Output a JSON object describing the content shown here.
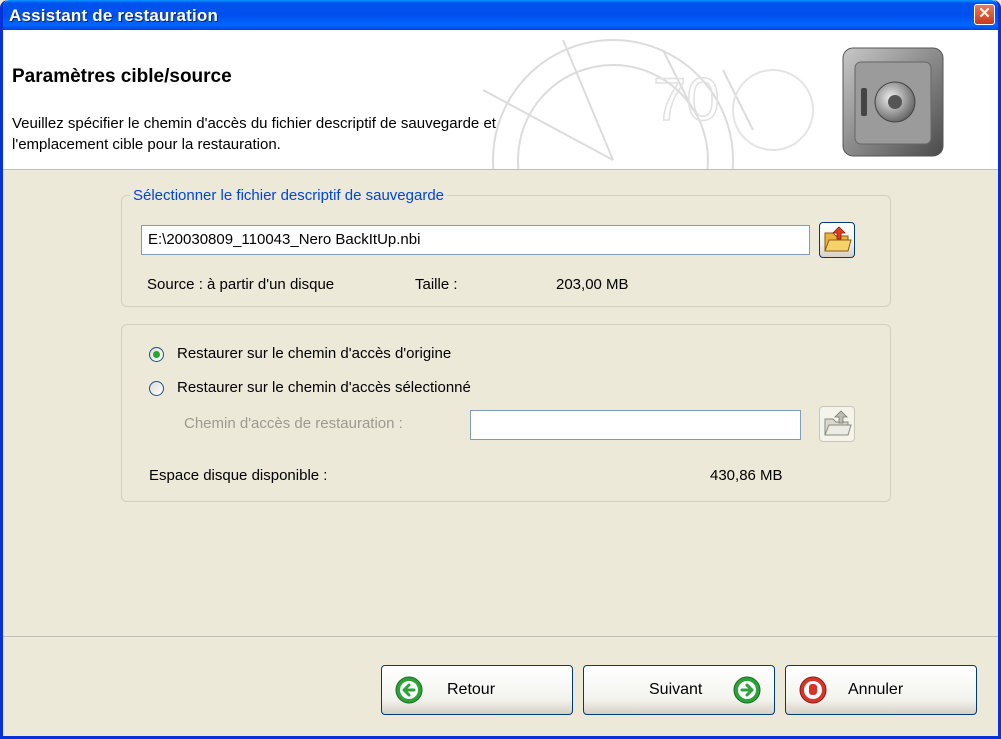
{
  "window": {
    "title": "Assistant de restauration",
    "close_glyph": "✕"
  },
  "header": {
    "title": "Paramètres cible/source",
    "description_line1": "Veuillez spécifier le chemin d'accès du fichier descriptif de sauvegarde et",
    "description_line2": "l'emplacement cible pour la restauration.",
    "decoration_icon": "safe-icon"
  },
  "file_group": {
    "legend": "Sélectionner le fichier descriptif de sauvegarde",
    "path_value": "E:\\20030809_110043_Nero BackItUp.nbi",
    "browse_icon": "folder-open-icon",
    "source_label": "Source : à partir d'un disque",
    "size_label": "Taille :",
    "size_value": "203,00 MB"
  },
  "restore_group": {
    "option_original": "Restaurer sur le chemin d'accès d'origine",
    "option_selected": "Restaurer sur le chemin d'accès sélectionné",
    "selected_option": "original",
    "restore_path_label": "Chemin d'accès de restauration :",
    "restore_path_value": "",
    "browse_icon": "folder-open-icon",
    "free_space_label": "Espace disque disponible :",
    "free_space_value": "430,86 MB"
  },
  "footer": {
    "back_label": "Retour",
    "next_label": "Suivant",
    "cancel_label": "Annuler"
  },
  "colors": {
    "titlebar": "#0054e3",
    "accent_green": "#2ea23a",
    "cancel_red": "#d8352a",
    "legend_blue": "#0046d5"
  }
}
